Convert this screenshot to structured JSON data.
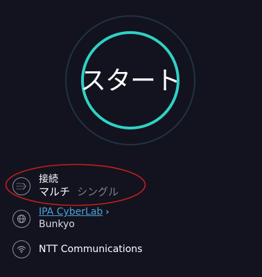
{
  "go_button": {
    "label": "スタート"
  },
  "connection": {
    "label": "接続",
    "option_active": "マルチ",
    "option_inactive": "シングル",
    "icon": "connections-icon"
  },
  "server": {
    "name": "IPA CyberLab",
    "chevron": "›",
    "location": "Bunkyo",
    "icon": "globe-icon"
  },
  "provider": {
    "name": "NTT Communications",
    "icon": "wifi-icon"
  },
  "colors": {
    "background": "#12131f",
    "accent": "#31d1c5",
    "link": "#4da3d9",
    "annotation": "#c81e1e"
  }
}
